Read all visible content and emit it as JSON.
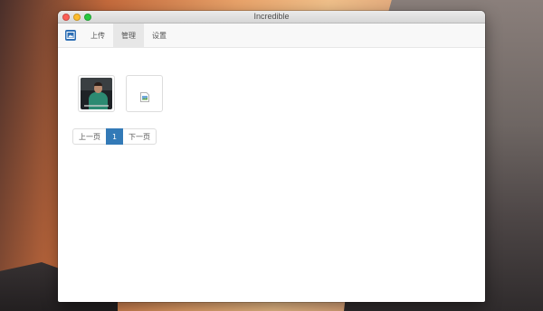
{
  "window": {
    "title": "Incredible"
  },
  "navbar": {
    "brand_icon": "picture-icon",
    "items": [
      {
        "label": "上传",
        "active": false
      },
      {
        "label": "管理",
        "active": true
      },
      {
        "label": "设置",
        "active": false
      }
    ]
  },
  "gallery": {
    "items": [
      {
        "type": "photo",
        "icon": "person-photo-thumbnail"
      },
      {
        "type": "broken",
        "icon": "broken-image-icon"
      }
    ]
  },
  "pagination": {
    "prev_label": "上一页",
    "current_page": "1",
    "next_label": "下一页"
  },
  "colors": {
    "accent": "#337ab7",
    "brand": "#2e6fb5",
    "close": "#fc5f57",
    "minimize": "#fdbc2e",
    "zoom": "#28c840"
  }
}
